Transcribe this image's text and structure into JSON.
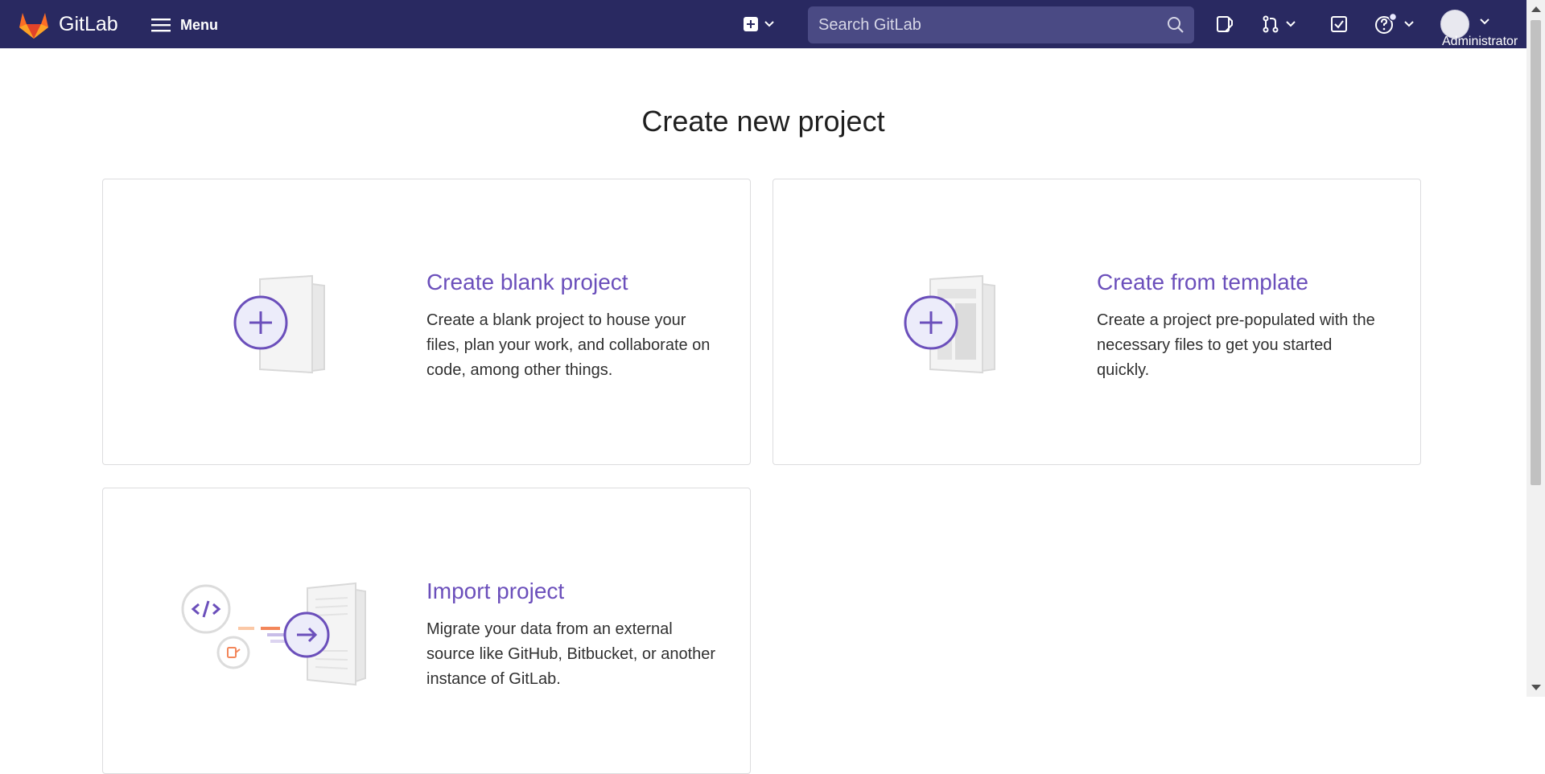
{
  "header": {
    "brand": "GitLab",
    "menu_label": "Menu",
    "search_placeholder": "Search GitLab",
    "user_label": "Administrator",
    "icons": [
      "gitlab-logo",
      "hamburger-icon",
      "plus-square-icon",
      "search-icon",
      "issues-icon",
      "merge-request-icon",
      "todo-icon",
      "help-icon",
      "avatar"
    ]
  },
  "page": {
    "title": "Create new project"
  },
  "cards": [
    {
      "title": "Create blank project",
      "description": "Create a blank project to house your files, plan your work, and collaborate on code, among other things."
    },
    {
      "title": "Create from template",
      "description": "Create a project pre-populated with the necessary files to get you started quickly."
    },
    {
      "title": "Import project",
      "description": "Migrate your data from an external source like GitHub, Bitbucket, or another instance of GitLab."
    }
  ],
  "colors": {
    "navbar": "#292961",
    "accent": "#6b4fbb",
    "search_bg": "#4a4a84",
    "card_border": "#dcdcde"
  }
}
